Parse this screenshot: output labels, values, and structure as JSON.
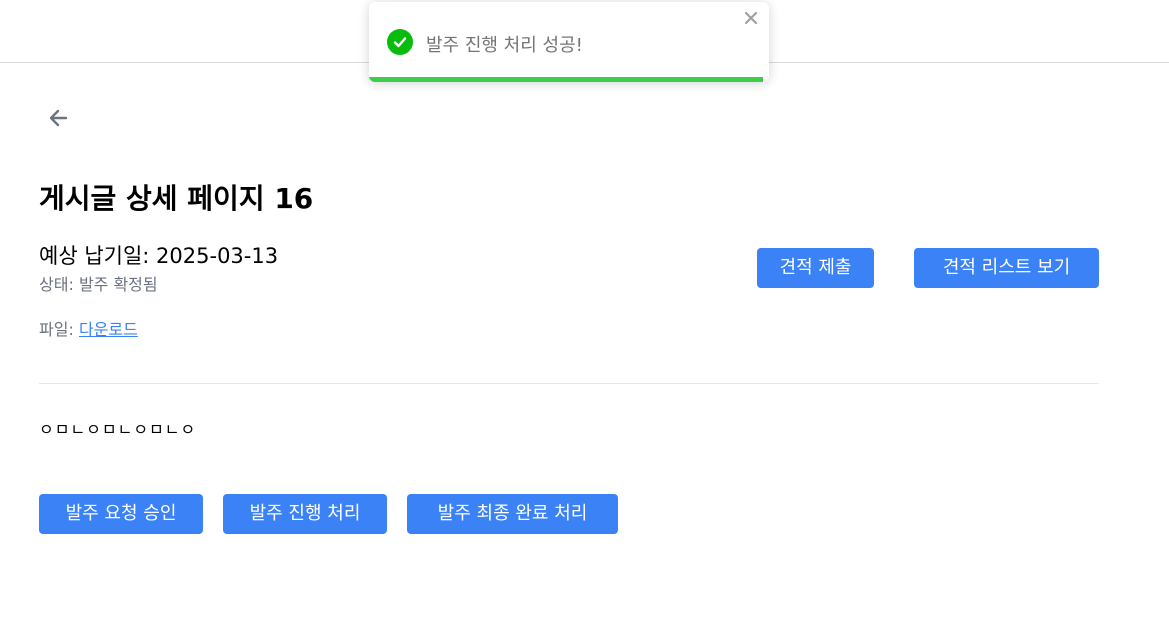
{
  "toast": {
    "message": "발주 진행 처리 성공!",
    "progress": 0.985,
    "status_color": "#07bc0c",
    "progress_color": "#3ecc4d",
    "icon": "check-circle-icon",
    "close_icon": "close-icon"
  },
  "nav": {
    "back_icon": "arrow-left-icon"
  },
  "post": {
    "title": "게시글 상세 페이지 16",
    "due_label": "예상 납기일:",
    "due_value": "2025-03-13",
    "status_label": "상태:",
    "status_value": "발주 확정됨",
    "file_label": "파일:",
    "file_link": "다운로드",
    "content": "ㅇㅁㄴㅇㅁㄴㅇㅁㄴㅇ"
  },
  "actions": {
    "submit_quote": "견적 제출",
    "view_quote_list": "견적 리스트 보기",
    "approve_order_request": "발주 요청 승인",
    "process_order": "발주 진행 처리",
    "complete_order": "발주 최종 완료 처리"
  },
  "colors": {
    "primary": "#3b82f6",
    "muted_text": "#6b7280"
  }
}
